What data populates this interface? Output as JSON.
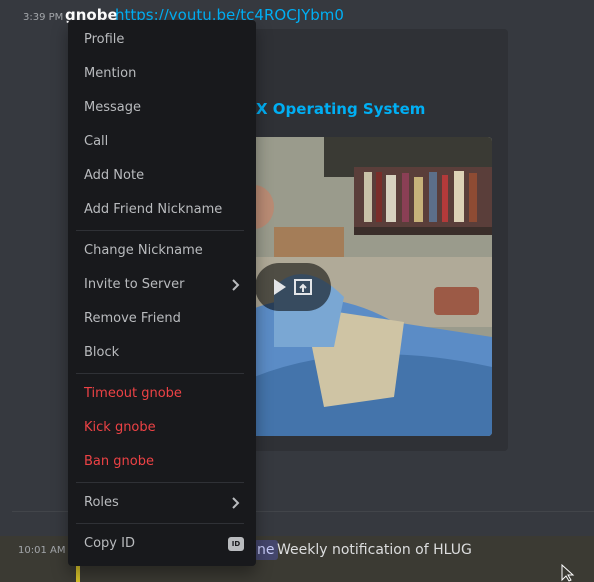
{
  "message_top": {
    "timestamp": "3:39 PM",
    "author": "gnobe",
    "link": "https://youtu.be/tc4ROCJYbm0"
  },
  "embed": {
    "title": "X Operating System"
  },
  "message_bottom": {
    "timestamp": "10:01 AM",
    "mention": "ne",
    "text": "Weekly notification of HLUG"
  },
  "context_menu": {
    "items": [
      {
        "label": "Profile"
      },
      {
        "label": "Mention"
      },
      {
        "label": "Message"
      },
      {
        "label": "Call"
      },
      {
        "label": "Add Note"
      },
      {
        "label": "Add Friend Nickname"
      },
      {
        "label": "Change Nickname"
      },
      {
        "label": "Invite to Server"
      },
      {
        "label": "Remove Friend"
      },
      {
        "label": "Block"
      },
      {
        "label": "Timeout gnobe"
      },
      {
        "label": "Kick gnobe"
      },
      {
        "label": "Ban gnobe"
      },
      {
        "label": "Roles"
      },
      {
        "label": "Copy ID"
      }
    ],
    "id_badge": "ID"
  },
  "colors": {
    "background": "#36393f",
    "menu": "#18191c",
    "link": "#00aff4",
    "danger": "#ed4245",
    "highlight_accent": "#d7c22b"
  }
}
